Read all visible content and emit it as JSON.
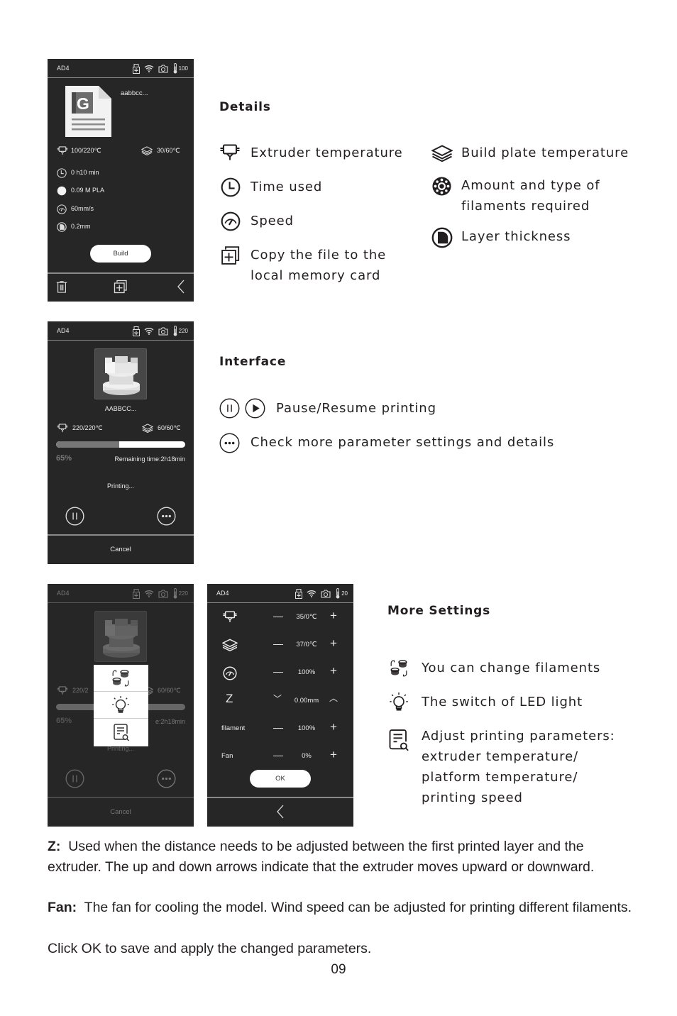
{
  "screens": {
    "details": {
      "model": "AD4",
      "status_temp": "100",
      "file_name": "aabbcc...",
      "extruder_temp": "100/220℃",
      "plate_temp": "30/60℃",
      "time": "0 h10 min",
      "filament": "0.09 M PLA",
      "speed": "60mm/s",
      "layer": "0.2mm",
      "build_label": "Build"
    },
    "printing": {
      "model": "AD4",
      "status_temp": "220",
      "file_name": "AABBCC...",
      "extruder_temp": "220/220℃",
      "plate_temp": "60/60℃",
      "progress_percent": 65,
      "progress_label": "65%",
      "remaining": "Remaining time:2h18min",
      "status": "Printing...",
      "cancel_label": "Cancel"
    },
    "menu_overlay": {
      "model": "AD4",
      "status_temp": "220",
      "extruder_temp": "220/2",
      "plate_temp": "60/60℃",
      "progress_label": "65%",
      "remaining": "e:2h18min",
      "status": "Printing...",
      "cancel_label": "Cancel",
      "menu_items": [
        "change-filament",
        "led-light",
        "adjust-parameters"
      ]
    },
    "settings": {
      "model": "AD4",
      "status_temp": "20",
      "rows": [
        {
          "key": "extruder",
          "value": "35/0℃"
        },
        {
          "key": "plate",
          "value": "37/0℃"
        },
        {
          "key": "speed",
          "value": "100%"
        },
        {
          "key": "z",
          "label": "Z",
          "value": "0.00mm"
        },
        {
          "key": "filament",
          "label": "filament",
          "value": "100%"
        },
        {
          "key": "fan",
          "label": "Fan",
          "value": "0%"
        }
      ],
      "ok_label": "OK"
    }
  },
  "details_section": {
    "title": "Details",
    "left_items": [
      "Extruder temperature",
      "Time used",
      "Speed",
      "Copy the file to the\nlocal memory card"
    ],
    "right_items": [
      "Build plate temperature",
      "Amount and type of\nfilaments required",
      "Layer thickness"
    ]
  },
  "interface_section": {
    "title": "Interface",
    "items": [
      "Pause/Resume printing",
      "Check more parameter settings and details"
    ]
  },
  "more_settings_section": {
    "title": "More Settings",
    "items": [
      "You can change filaments",
      "The switch of LED light",
      "Adjust printing parameters:\nextruder temperature/\nplatform temperature/\nprinting speed"
    ]
  },
  "notes": {
    "z_label": "Z:",
    "z_text": "Used when the distance needs to be adjusted between the first printed layer and the extruder. The up and down arrows indicate that the extruder moves upward or downward.",
    "fan_label": "Fan:",
    "fan_text": "The fan for cooling the model. Wind speed can be adjusted for printing different filaments.",
    "ok_text": "Click OK to save and apply the changed parameters."
  },
  "page_number": "09"
}
